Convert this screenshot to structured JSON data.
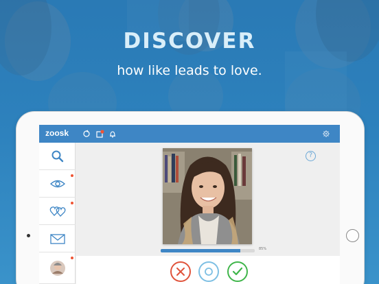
{
  "headline": "DISCOVER",
  "subline": "how like leads to love.",
  "app": {
    "logo": "zoosk",
    "topbar_icons": [
      "sync-icon",
      "message-badge-icon",
      "bell-icon"
    ],
    "settings_icon": "gear-icon",
    "accent": "#3e86c5"
  },
  "sidebar": {
    "items": [
      {
        "icon": "search-icon",
        "active": true,
        "badge": false
      },
      {
        "icon": "eye-icon",
        "active": false,
        "badge": true
      },
      {
        "icon": "hearts-icon",
        "active": false,
        "badge": true
      },
      {
        "icon": "envelope-icon",
        "active": false,
        "badge": false
      },
      {
        "icon": "avatar",
        "active": false,
        "badge": true
      }
    ]
  },
  "carousel": {
    "help_label": "?",
    "progress_fraction": 0.85,
    "progress_text": "85%"
  },
  "actions": {
    "no_icon": "x-icon",
    "maybe_icon": "ring-icon",
    "yes_icon": "check-icon",
    "no_color": "#e0533b",
    "maybe_color": "#7dbfe3",
    "yes_color": "#3fb54a"
  }
}
